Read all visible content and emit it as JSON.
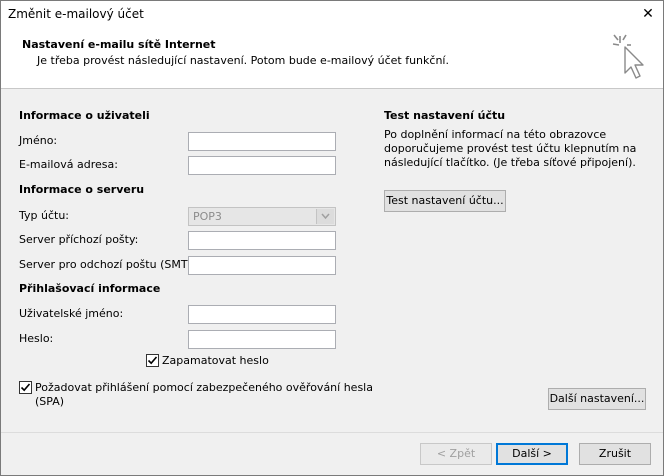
{
  "window": {
    "title": "Změnit e-mailový účet",
    "close": "✕"
  },
  "header": {
    "title": "Nastavení e-mailu sítě Internet",
    "subtitle": "Je třeba provést následující nastavení. Potom bude e-mailový účet funkční.",
    "icon": "cursor-sparkle-icon"
  },
  "user_info": {
    "heading": "Informace o uživateli",
    "name_label": "Jméno:",
    "name_value": "",
    "email_label": "E-mailová adresa:",
    "email_value": ""
  },
  "server_info": {
    "heading": "Informace o serveru",
    "account_type_label": "Typ účtu:",
    "account_type_value": "POP3",
    "incoming_label": "Server příchozí pošty:",
    "incoming_value": "",
    "outgoing_label": "Server pro odchozí poštu (SMTP):",
    "outgoing_value": ""
  },
  "login_info": {
    "heading": "Přihlašovací informace",
    "username_label": "Uživatelské jméno:",
    "username_value": "",
    "password_label": "Heslo:",
    "password_value": "",
    "remember_label": "Zapamatovat heslo",
    "remember_checked": true,
    "spa_label_line1": "Požadovat přihlášení pomocí zabezpečeného ověřování hesla",
    "spa_label_line2": "(SPA)",
    "spa_checked": true
  },
  "test": {
    "heading": "Test nastavení účtu",
    "description": "Po doplnění informací na této obrazovce doporučujeme provést test účtu klepnutím na následující tlačítko. (Je třeba síťové připojení).",
    "button": "Test nastavení účtu..."
  },
  "buttons": {
    "more_settings": "Další nastavení...",
    "back": "< Zpět",
    "next": "Další >",
    "cancel": "Zrušit"
  }
}
